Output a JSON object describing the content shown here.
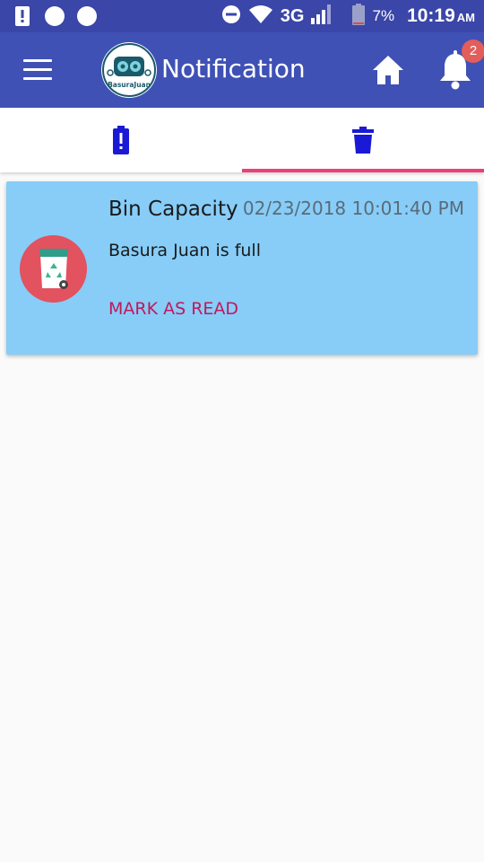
{
  "status_bar": {
    "network": "3G",
    "battery_percent": "7%",
    "time": "10:19",
    "ampm": "AM"
  },
  "app_bar": {
    "title": "Notification",
    "notification_count": "2",
    "logo_text": "BasuraJuan"
  },
  "tabs": [
    {
      "icon": "battery-alert-icon",
      "selected": false
    },
    {
      "icon": "trash-icon",
      "selected": true
    }
  ],
  "notifications": [
    {
      "title": "Bin Capacity",
      "timestamp": "02/23/2018 10:01:40 PM",
      "message": "Basura Juan is full",
      "action": "MARK AS READ",
      "icon": "recycle-bin-icon"
    }
  ],
  "colors": {
    "status_bar": "#3a46a8",
    "app_bar": "#3f51b5",
    "tab_icon": "#1a1ad6",
    "tab_indicator": "#e94079",
    "card_bg": "#87cdf8",
    "avatar_bg": "#e2525f",
    "action_text": "#c2185b"
  }
}
